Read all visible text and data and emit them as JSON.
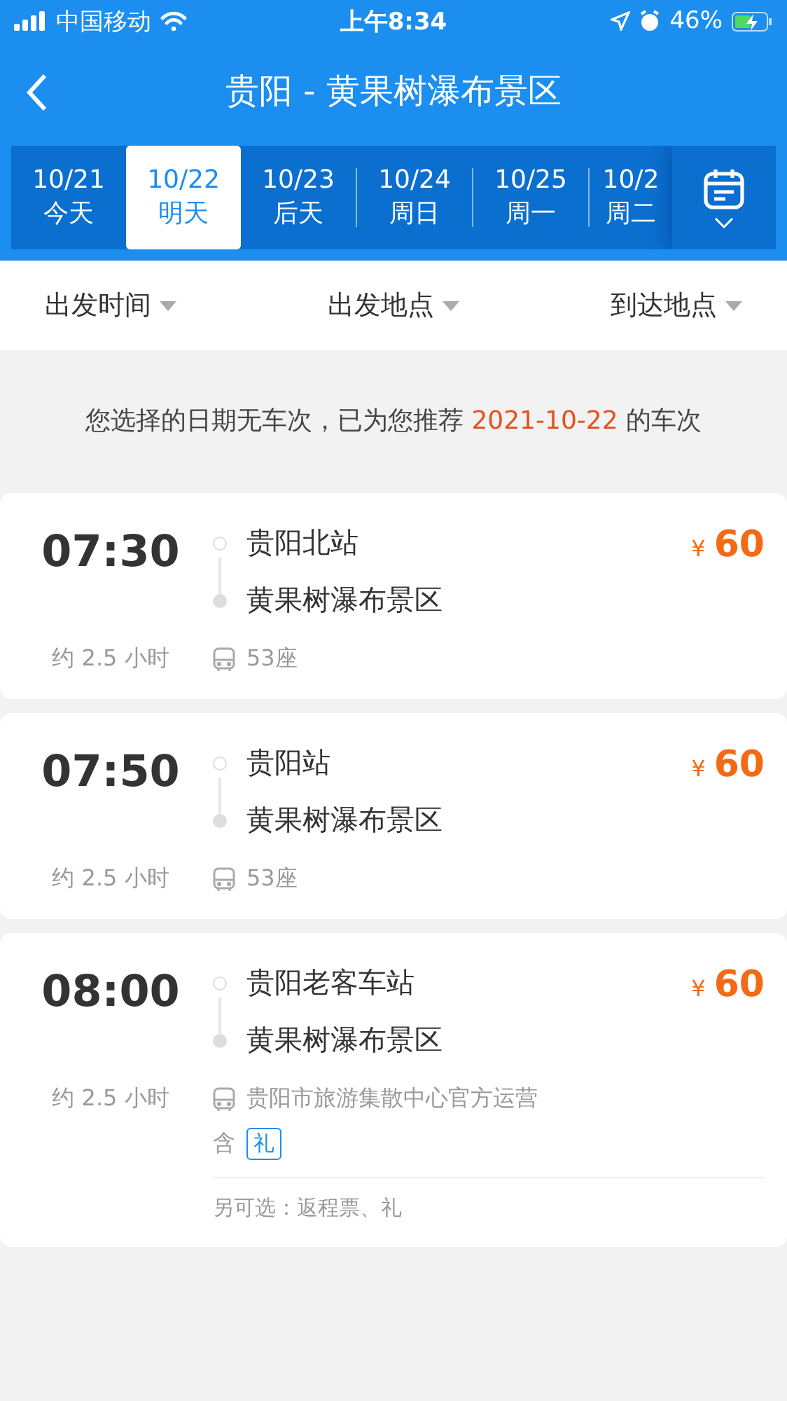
{
  "status_bar": {
    "carrier": "中国移动",
    "time": "上午8:34",
    "battery": "46%"
  },
  "header": {
    "title": "贵阳 - 黄果树瀑布景区"
  },
  "dates": [
    {
      "date": "10/21",
      "label": "今天",
      "selected": false
    },
    {
      "date": "10/22",
      "label": "明天",
      "selected": true
    },
    {
      "date": "10/23",
      "label": "后天",
      "selected": false
    },
    {
      "date": "10/24",
      "label": "周日",
      "selected": false
    },
    {
      "date": "10/25",
      "label": "周一",
      "selected": false
    },
    {
      "date": "10/2",
      "label": "周二",
      "selected": false
    }
  ],
  "filters": [
    "出发时间",
    "出发地点",
    "到达地点"
  ],
  "notice": "您选择的日期无车次，已为您推荐 **2021-10-22** 的车次",
  "trips": [
    {
      "time": "07:30",
      "from": "贵阳北站",
      "to": "黄果树瀑布景区",
      "duration": "约 2.5 小时",
      "info": "53座",
      "currency": "¥",
      "price": "60"
    },
    {
      "time": "07:50",
      "from": "贵阳站",
      "to": "黄果树瀑布景区",
      "duration": "约 2.5 小时",
      "info": "53座",
      "currency": "¥",
      "price": "60"
    },
    {
      "time": "08:00",
      "from": "贵阳老客车站",
      "to": "黄果树瀑布景区",
      "duration": "约 2.5 小时",
      "info": "贵阳市旅游集散中心官方运营",
      "currency": "¥",
      "price": "60",
      "includes": {
        "label": "含",
        "tag": "礼"
      },
      "options": "另可选：返程票、礼"
    }
  ]
}
